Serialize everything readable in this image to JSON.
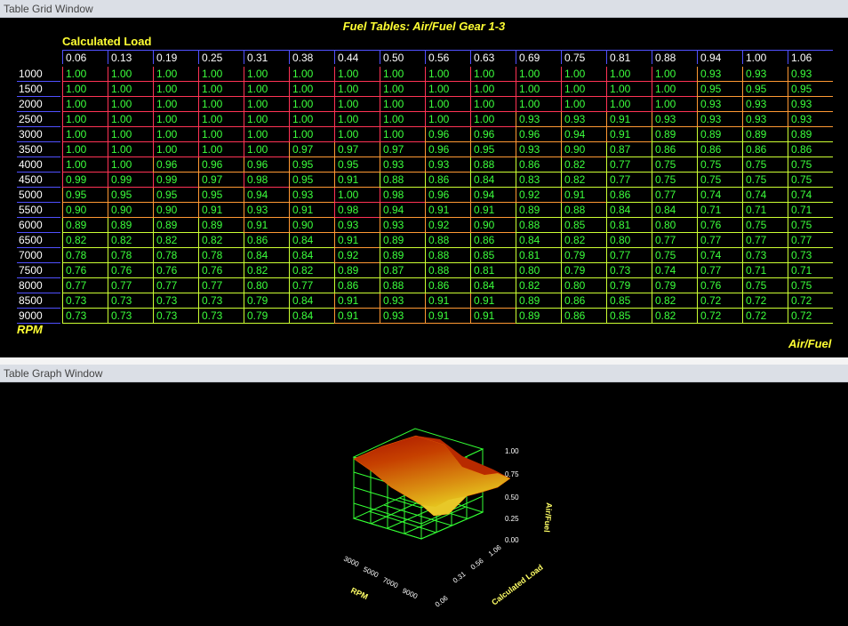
{
  "windows": {
    "grid_title": "Table Grid Window",
    "graph_title": "Table Graph Window"
  },
  "table": {
    "title": "Fuel Tables: Air/Fuel Gear 1-3",
    "x_label": "Calculated Load",
    "y_label": "RPM",
    "value_label": "Air/Fuel",
    "columns": [
      "0.06",
      "0.13",
      "0.19",
      "0.25",
      "0.31",
      "0.38",
      "0.44",
      "0.50",
      "0.56",
      "0.63",
      "0.69",
      "0.75",
      "0.81",
      "0.88",
      "0.94",
      "1.00",
      "1.06"
    ],
    "rows": [
      "1000",
      "1500",
      "2000",
      "2500",
      "3000",
      "3500",
      "4000",
      "4500",
      "5000",
      "5500",
      "6000",
      "6500",
      "7000",
      "7500",
      "8000",
      "8500",
      "9000"
    ],
    "values": [
      [
        "1.00",
        "1.00",
        "1.00",
        "1.00",
        "1.00",
        "1.00",
        "1.00",
        "1.00",
        "1.00",
        "1.00",
        "1.00",
        "1.00",
        "1.00",
        "1.00",
        "0.93",
        "0.93",
        "0.93"
      ],
      [
        "1.00",
        "1.00",
        "1.00",
        "1.00",
        "1.00",
        "1.00",
        "1.00",
        "1.00",
        "1.00",
        "1.00",
        "1.00",
        "1.00",
        "1.00",
        "1.00",
        "0.95",
        "0.95",
        "0.95"
      ],
      [
        "1.00",
        "1.00",
        "1.00",
        "1.00",
        "1.00",
        "1.00",
        "1.00",
        "1.00",
        "1.00",
        "1.00",
        "1.00",
        "1.00",
        "1.00",
        "1.00",
        "0.93",
        "0.93",
        "0.93"
      ],
      [
        "1.00",
        "1.00",
        "1.00",
        "1.00",
        "1.00",
        "1.00",
        "1.00",
        "1.00",
        "1.00",
        "1.00",
        "0.93",
        "0.93",
        "0.91",
        "0.93",
        "0.93",
        "0.93",
        "0.93"
      ],
      [
        "1.00",
        "1.00",
        "1.00",
        "1.00",
        "1.00",
        "1.00",
        "1.00",
        "1.00",
        "0.96",
        "0.96",
        "0.96",
        "0.94",
        "0.91",
        "0.89",
        "0.89",
        "0.89",
        "0.89"
      ],
      [
        "1.00",
        "1.00",
        "1.00",
        "1.00",
        "1.00",
        "0.97",
        "0.97",
        "0.97",
        "0.96",
        "0.95",
        "0.93",
        "0.90",
        "0.87",
        "0.86",
        "0.86",
        "0.86",
        "0.86"
      ],
      [
        "1.00",
        "1.00",
        "0.96",
        "0.96",
        "0.96",
        "0.95",
        "0.95",
        "0.93",
        "0.93",
        "0.88",
        "0.86",
        "0.82",
        "0.77",
        "0.75",
        "0.75",
        "0.75",
        "0.75"
      ],
      [
        "0.99",
        "0.99",
        "0.99",
        "0.97",
        "0.98",
        "0.95",
        "0.91",
        "0.88",
        "0.86",
        "0.84",
        "0.83",
        "0.82",
        "0.77",
        "0.75",
        "0.75",
        "0.75",
        "0.75"
      ],
      [
        "0.95",
        "0.95",
        "0.95",
        "0.95",
        "0.94",
        "0.93",
        "1.00",
        "0.98",
        "0.96",
        "0.94",
        "0.92",
        "0.91",
        "0.86",
        "0.77",
        "0.74",
        "0.74",
        "0.74"
      ],
      [
        "0.90",
        "0.90",
        "0.90",
        "0.91",
        "0.93",
        "0.91",
        "0.98",
        "0.94",
        "0.91",
        "0.91",
        "0.89",
        "0.88",
        "0.84",
        "0.84",
        "0.71",
        "0.71",
        "0.71"
      ],
      [
        "0.89",
        "0.89",
        "0.89",
        "0.89",
        "0.91",
        "0.90",
        "0.93",
        "0.93",
        "0.92",
        "0.90",
        "0.88",
        "0.85",
        "0.81",
        "0.80",
        "0.76",
        "0.75",
        "0.75"
      ],
      [
        "0.82",
        "0.82",
        "0.82",
        "0.82",
        "0.86",
        "0.84",
        "0.91",
        "0.89",
        "0.88",
        "0.86",
        "0.84",
        "0.82",
        "0.80",
        "0.77",
        "0.77",
        "0.77",
        "0.77"
      ],
      [
        "0.78",
        "0.78",
        "0.78",
        "0.78",
        "0.84",
        "0.84",
        "0.92",
        "0.89",
        "0.88",
        "0.85",
        "0.81",
        "0.79",
        "0.77",
        "0.75",
        "0.74",
        "0.73",
        "0.73"
      ],
      [
        "0.76",
        "0.76",
        "0.76",
        "0.76",
        "0.82",
        "0.82",
        "0.89",
        "0.87",
        "0.88",
        "0.81",
        "0.80",
        "0.79",
        "0.73",
        "0.74",
        "0.77",
        "0.71",
        "0.71"
      ],
      [
        "0.77",
        "0.77",
        "0.77",
        "0.77",
        "0.80",
        "0.77",
        "0.86",
        "0.88",
        "0.86",
        "0.84",
        "0.82",
        "0.80",
        "0.79",
        "0.79",
        "0.76",
        "0.75",
        "0.75"
      ],
      [
        "0.73",
        "0.73",
        "0.73",
        "0.73",
        "0.79",
        "0.84",
        "0.91",
        "0.93",
        "0.91",
        "0.91",
        "0.89",
        "0.86",
        "0.85",
        "0.82",
        "0.72",
        "0.72",
        "0.72"
      ],
      [
        "0.73",
        "0.73",
        "0.73",
        "0.73",
        "0.79",
        "0.84",
        "0.91",
        "0.93",
        "0.91",
        "0.91",
        "0.89",
        "0.86",
        "0.85",
        "0.82",
        "0.72",
        "0.72",
        "0.72"
      ]
    ]
  },
  "graph": {
    "z_ticks": [
      "1.00",
      "0.75",
      "0.50",
      "0.25",
      "0.00"
    ],
    "z_label": "Air/Fuel",
    "load_ticks": [
      "1.06",
      "0.56",
      "0.31",
      "0.06"
    ],
    "load_label": "Calculated Load",
    "rpm_ticks": [
      "3000",
      "5000",
      "7000",
      "9000"
    ],
    "rpm_label": "RPM"
  },
  "colors": {
    "title_yellow": "#ffff33",
    "value_green": "#3cff3c",
    "header_line": "#5050ff",
    "grid_green": "#33ff33"
  }
}
